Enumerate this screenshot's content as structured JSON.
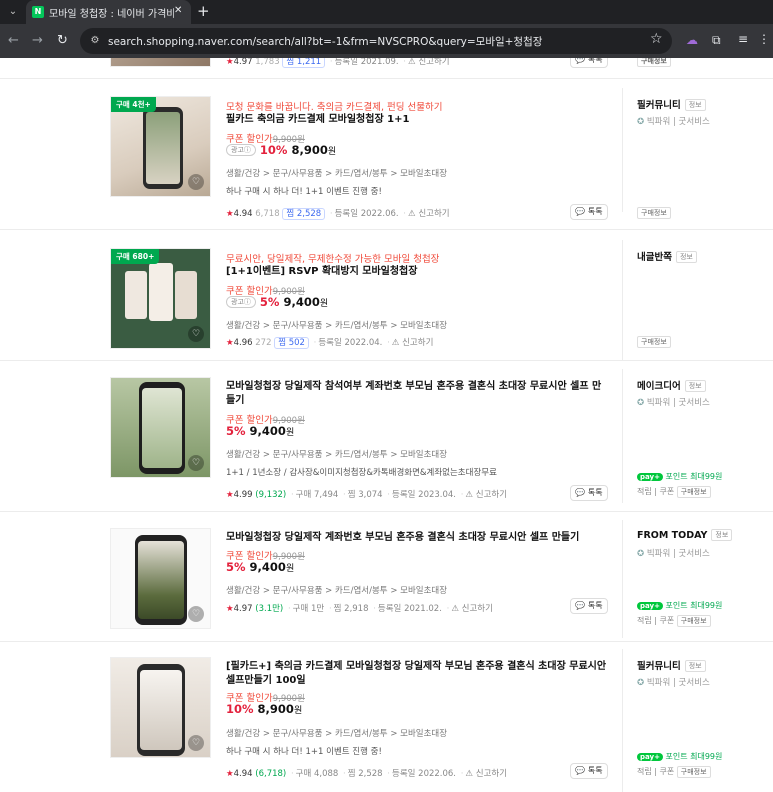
{
  "browser": {
    "tab_title": "모바일 청첩장 : 네이버 가격비교",
    "url": "search.shopping.naver.com/search/all?bt=-1&frm=NVSCPRO&query=모바일+청첩장"
  },
  "top_partial": {
    "rating": "4.97",
    "reviews": "1,783",
    "zim": "찜 1,211",
    "reg_date": "등록일 2021.09.",
    "report": "신고하기",
    "talk": "톡톡",
    "buy_info": "구매정보"
  },
  "items": [
    {
      "badge": "구매 4천+",
      "promo": "모청 문화를 바꿉니다. 축의금 카드결제, 펀딩 선물하기",
      "title": "필카드 축의금 카드결제 모바일청첩장 1+1",
      "coupon": "쿠폰 할인가",
      "orig_price": "9,900원",
      "ad": "광고ⓘ",
      "rate": "10%",
      "price": "8,900",
      "won": "원",
      "category": "생활/건강 > 문구/사무용품 > 카드/엽서/봉투 > 모바일초대장",
      "desc": "하나 구매 시 하나 더! 1+1 이벤트 진행 중!",
      "rating": "4.94",
      "reviews": "6,718",
      "zim": "찜 2,528",
      "reg_date": "등록일 2022.06.",
      "report": "신고하기",
      "talk": "톡톡",
      "mall": "필커뮤니티",
      "mall_info": "정보",
      "grade": "빅파워 | 굿서비스",
      "buy_info": "구매정보"
    },
    {
      "badge": "구매 680+",
      "promo": "무료시안, 당일제작, 무제한수정 가능한 모바일 청첩장",
      "title": "[1+1이벤트] RSVP 확대방지 모바일청첩장",
      "coupon": "쿠폰 할인가",
      "orig_price": "9,900원",
      "ad": "광고ⓘ",
      "rate": "5%",
      "price": "9,400",
      "won": "원",
      "category": "생활/건강 > 문구/사무용품 > 카드/엽서/봉투 > 모바일초대장",
      "rating": "4.96",
      "reviews": "272",
      "zim": "찜 502",
      "reg_date": "등록일 2022.04.",
      "report": "신고하기",
      "mall": "내글반쪽",
      "mall_info": "정보",
      "buy_info": "구매정보"
    },
    {
      "title": "모바일청첩장 당일제작 참석여부 계좌번호 부모님 혼주용 결혼식 초대장 무료시안 셀프 만들기",
      "coupon": "쿠폰 할인가",
      "orig_price": "9,900원",
      "rate": "5%",
      "price": "9,400",
      "won": "원",
      "category": "생활/건강 > 문구/사무용품 > 카드/엽서/봉투 > 모바일초대장",
      "desc": "1+1 / 1년소장 / 감사장&이미지청첩장&카톡배경화면&계좌없는초대장무료",
      "rating": "4.99",
      "reviews": "(9,132)",
      "buy": "구매 7,494",
      "zim": "찜 3,074",
      "reg_date": "등록일 2023.04.",
      "report": "신고하기",
      "talk": "톡톡",
      "mall": "메이크디어",
      "mall_info": "정보",
      "grade": "빅파워 | 굿서비스",
      "npay": "포인트 최대99원",
      "npay_tag": "pay+",
      "sub": "적립 | 쿠폰",
      "buy_info": "구매정보"
    },
    {
      "title": "모바일청첩장 당일제작 계좌번호 부모님 혼주용 결혼식 초대장 무료시안 셀프 만들기",
      "coupon": "쿠폰 할인가",
      "orig_price": "9,900원",
      "rate": "5%",
      "price": "9,400",
      "won": "원",
      "category": "생활/건강 > 문구/사무용품 > 카드/엽서/봉투 > 모바일초대장",
      "rating": "4.97",
      "reviews": "(3.1만)",
      "buy": "구매 1만",
      "zim": "찜 2,918",
      "reg_date": "등록일 2021.02.",
      "report": "신고하기",
      "talk": "톡톡",
      "mall": "FROM TODAY",
      "mall_info": "정보",
      "grade": "빅파워 | 굿서비스",
      "npay": "포인트 최대99원",
      "npay_tag": "pay+",
      "sub": "적립 | 쿠폰",
      "buy_info": "구매정보"
    },
    {
      "title": "[필카드+] 축의금 카드결제 모바일청첩장 당일제작 부모님 혼주용 결혼식 초대장 무료시안 셀프만들기 100일",
      "coupon": "쿠폰 할인가",
      "orig_price": "9,900원",
      "rate": "10%",
      "price": "8,900",
      "won": "원",
      "category": "생활/건강 > 문구/사무용품 > 카드/엽서/봉투 > 모바일초대장",
      "desc": "하나 구매 시 하나 더! 1+1 이벤트 진행 중!",
      "rating": "4.94",
      "reviews": "(6,718)",
      "buy": "구매 4,088",
      "zim": "찜 2,528",
      "reg_date": "등록일 2022.06.",
      "report": "신고하기",
      "talk": "톡톡",
      "mall": "필커뮤니티",
      "mall_info": "정보",
      "grade": "빅파워 | 굿서비스",
      "npay": "포인트 최대99원",
      "npay_tag": "pay+",
      "sub": "적립 | 쿠폰",
      "buy_info": "구매정보"
    }
  ]
}
